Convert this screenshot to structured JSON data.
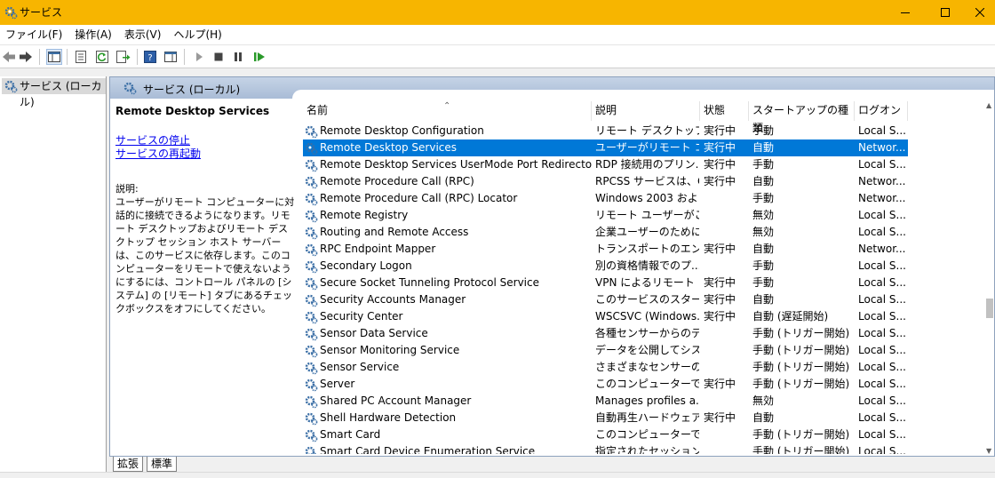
{
  "window": {
    "title": "サービス",
    "accent": "#f7b500"
  },
  "menu": [
    {
      "label": "ファイル(F)"
    },
    {
      "label": "操作(A)"
    },
    {
      "label": "表示(V)"
    },
    {
      "label": "ヘルプ(H)"
    }
  ],
  "toolbar": {
    "icons": [
      "back-arrow-icon",
      "forward-arrow-icon",
      "console-tree-icon",
      "properties-icon",
      "refresh-icon",
      "export-list-icon",
      "help-icon",
      "show-hide-action-pane-icon",
      "start-service-icon",
      "stop-service-icon",
      "pause-service-icon",
      "restart-service-icon"
    ]
  },
  "tree": {
    "root_label": "サービス (ローカル)"
  },
  "pane": {
    "header_label": "サービス (ローカル)",
    "selected_name": "Remote Desktop Services",
    "link_stop": "サービスの停止",
    "link_restart": "サービスの再起動",
    "desc_label": "説明:",
    "desc_text": "ユーザーがリモート コンピューターに対話的に接続できるようになります。リモート デスクトップおよびリモート デスクトップ セッション ホスト サーバーは、このサービスに依存します。このコンピューターをリモートで使えないようにするには、コントロール パネルの [システム] の [リモート] タブにあるチェックボックスをオフにしてください。"
  },
  "table": {
    "columns": [
      "名前",
      "説明",
      "状態",
      "スタートアップの種類",
      "ログオン"
    ],
    "selection_color": "#0078d7",
    "rows": [
      {
        "name": "Remote Desktop Configuration",
        "desc": "リモート デスクトップ サ...",
        "status": "実行中",
        "startup": "手動",
        "logon": "Local S..."
      },
      {
        "name": "Remote Desktop Services",
        "desc": "ユーザーがリモート コン...",
        "status": "実行中",
        "startup": "自動",
        "logon": "Networ...",
        "selected": true
      },
      {
        "name": "Remote Desktop Services UserMode Port Redirector",
        "desc": "RDP 接続用のプリン...",
        "status": "実行中",
        "startup": "手動",
        "logon": "Local S..."
      },
      {
        "name": "Remote Procedure Call (RPC)",
        "desc": "RPCSS サービスは、C...",
        "status": "実行中",
        "startup": "自動",
        "logon": "Networ..."
      },
      {
        "name": "Remote Procedure Call (RPC) Locator",
        "desc": "Windows 2003 およ...",
        "status": "",
        "startup": "手動",
        "logon": "Networ..."
      },
      {
        "name": "Remote Registry",
        "desc": "リモート ユーザーがこの...",
        "status": "",
        "startup": "無効",
        "logon": "Local S..."
      },
      {
        "name": "Routing and Remote Access",
        "desc": "企業ユーザーのために...",
        "status": "",
        "startup": "無効",
        "logon": "Local S..."
      },
      {
        "name": "RPC Endpoint Mapper",
        "desc": "トランスポートのエンドポ...",
        "status": "実行中",
        "startup": "自動",
        "logon": "Networ..."
      },
      {
        "name": "Secondary Logon",
        "desc": "別の資格情報でのプ...",
        "status": "",
        "startup": "手動",
        "logon": "Local S..."
      },
      {
        "name": "Secure Socket Tunneling Protocol Service",
        "desc": "VPN によるリモート コ...",
        "status": "実行中",
        "startup": "手動",
        "logon": "Local S..."
      },
      {
        "name": "Security Accounts Manager",
        "desc": "このサービスのスタート...",
        "status": "実行中",
        "startup": "自動",
        "logon": "Local S..."
      },
      {
        "name": "Security Center",
        "desc": "WSCSVC (Windows...",
        "status": "実行中",
        "startup": "自動 (遅延開始)",
        "logon": "Local S..."
      },
      {
        "name": "Sensor Data Service",
        "desc": "各種センサーからのデ...",
        "status": "",
        "startup": "手動 (トリガー開始)",
        "logon": "Local S..."
      },
      {
        "name": "Sensor Monitoring Service",
        "desc": "データを公開してシス...",
        "status": "",
        "startup": "手動 (トリガー開始)",
        "logon": "Local S..."
      },
      {
        "name": "Sensor Service",
        "desc": "さまざまなセンサーの...",
        "status": "",
        "startup": "手動 (トリガー開始)",
        "logon": "Local S..."
      },
      {
        "name": "Server",
        "desc": "このコンピューターでネ...",
        "status": "実行中",
        "startup": "手動 (トリガー開始)",
        "logon": "Local S..."
      },
      {
        "name": "Shared PC Account Manager",
        "desc": "Manages profiles a...",
        "status": "",
        "startup": "無効",
        "logon": "Local S..."
      },
      {
        "name": "Shell Hardware Detection",
        "desc": "自動再生ハードウェア ...",
        "status": "実行中",
        "startup": "自動",
        "logon": "Local S..."
      },
      {
        "name": "Smart Card",
        "desc": "このコンピューターで読...",
        "status": "",
        "startup": "手動 (トリガー開始)",
        "logon": "Local S..."
      },
      {
        "name": "Smart Card Device Enumeration Service",
        "desc": "指定されたセッション...",
        "status": "",
        "startup": "手動 (トリガー開始)",
        "logon": "Local S..."
      }
    ]
  },
  "tabs": [
    {
      "label": "拡張"
    },
    {
      "label": "標準"
    }
  ]
}
